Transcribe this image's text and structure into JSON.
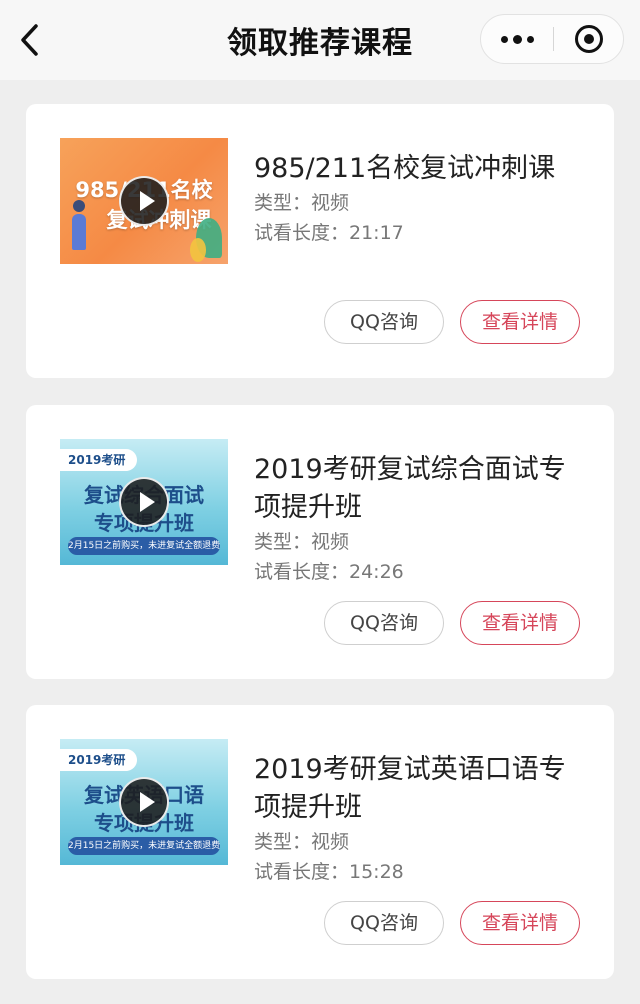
{
  "navbar": {
    "title": "领取推荐课程",
    "back_icon": "chevron-left-icon",
    "more_icon": "more-dots-icon",
    "close_icon": "target-circle-icon"
  },
  "colors": {
    "accent": "#d6465a",
    "background": "#eeeeee"
  },
  "courses": [
    {
      "title": "985/211名校复试冲刺课",
      "type": "类型：视频",
      "duration": "试看长度：21:17",
      "thumb_line1": "985/211名校",
      "thumb_line2": "复试冲刺课",
      "qq_label": "QQ咨询",
      "detail_label": "查看详情"
    },
    {
      "title": "2019考研复试综合面试专项提升班",
      "type": "类型：视频",
      "duration": "试看长度：24:26",
      "thumb_badge": "2019考研",
      "thumb_line1": "复试综合面试",
      "thumb_line2": "专项提升班",
      "thumb_strip": "2月15日之前购买，未进复试全额退费",
      "qq_label": "QQ咨询",
      "detail_label": "查看详情"
    },
    {
      "title": "2019考研复试英语口语专项提升班",
      "type": "类型：视频",
      "duration": "试看长度：15:28",
      "thumb_badge": "2019考研",
      "thumb_line1": "复试英语口语",
      "thumb_line2": "专项提升班",
      "thumb_strip": "2月15日之前购买，未进复试全额退费",
      "qq_label": "QQ咨询",
      "detail_label": "查看详情"
    }
  ]
}
